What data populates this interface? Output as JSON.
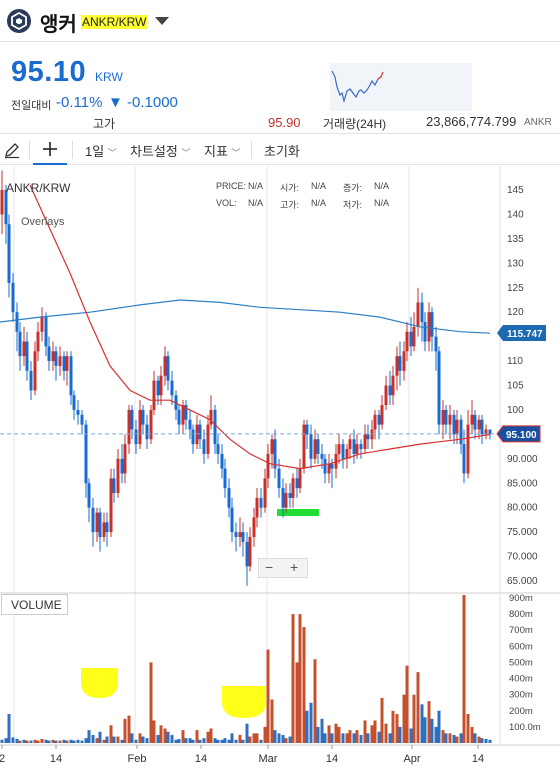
{
  "header": {
    "coin_name": "앵커",
    "pair": "ANKR/KRW"
  },
  "ticker": {
    "price": "95.10",
    "unit": "KRW",
    "change_label": "전일대비",
    "change_rate": "-0.11%",
    "change_amount": "▼ -0.1000",
    "high_label": "고가",
    "high_value": "95.90",
    "volume_label": "거래량(24H)",
    "volume_value": "23,866,774.799",
    "volume_unit": "ANKR"
  },
  "toolbar": {
    "interval": "1일",
    "chart_settings": "차트설정",
    "indicators": "지표",
    "reset": "초기화"
  },
  "chart": {
    "pair_label": "ANKR/KRW",
    "overlays_label": "Overlays",
    "price_label": "PRICE:",
    "price_val": "N/A",
    "vol_label": "VOL:",
    "vol_val": "N/A",
    "open_label": "시가:",
    "open_val": "N/A",
    "high_label": "고가:",
    "high_val": "N/A",
    "change_label": "증가:",
    "change_val": "N/A",
    "low_label": "저가:",
    "low_val": "N/A",
    "zoom_out": "−",
    "zoom_in": "+",
    "volume_tab": "VOLUME",
    "price_ticks": [
      "145",
      "140",
      "135",
      "130",
      "125",
      "120",
      "115",
      "110",
      "105",
      "100",
      "95",
      "90.000",
      "85.000",
      "80.000",
      "75.000",
      "70.000",
      "65.000"
    ],
    "volume_ticks": [
      "900m",
      "800m",
      "700m",
      "600m",
      "500m",
      "400m",
      "300m",
      "200m",
      "100.0m"
    ],
    "date_ticks": [
      "2",
      "14",
      "Feb",
      "14",
      "Mar",
      "14",
      "Apr",
      "14"
    ],
    "ma_long_label": "115.747",
    "last_price_label": "95.100"
  },
  "colors": {
    "up": "#c8312b",
    "down": "#1a6bd0",
    "accent": "#1a6bd0",
    "ma_long": "#2a7fc9",
    "ma_short": "#d93030",
    "highlight_yellow": "#ffff1a",
    "highlight_green": "#22dd33"
  },
  "chart_data": {
    "type": "candlestick",
    "price_range": [
      63,
      149
    ],
    "volume_range_m": [
      0,
      900
    ],
    "long_ma_last": 115.747,
    "last_price": 95.1,
    "x_ticks": [
      "2",
      "14",
      "Feb",
      "14",
      "Mar",
      "14",
      "Apr",
      "14"
    ]
  }
}
